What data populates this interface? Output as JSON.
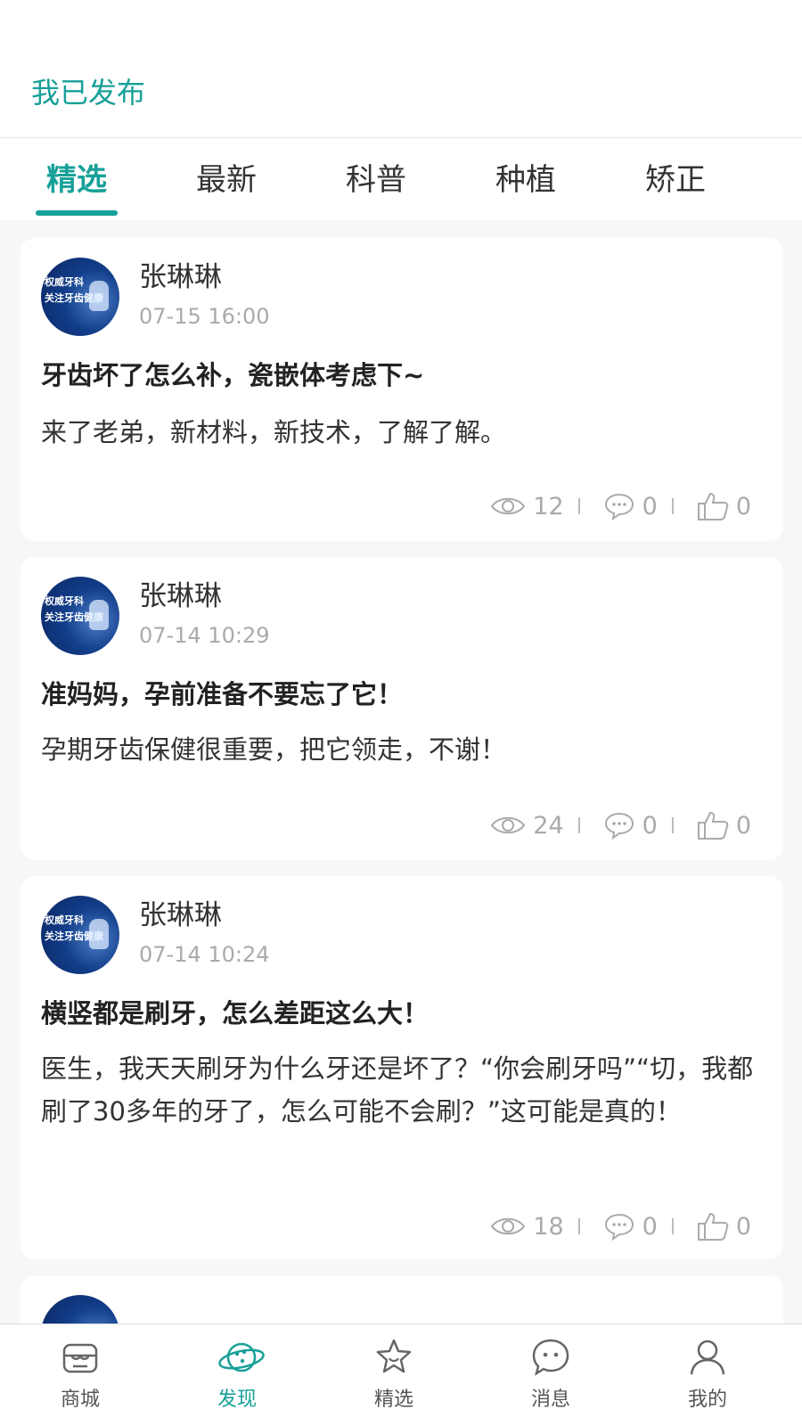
{
  "header": {
    "published_label": "我已发布"
  },
  "tabs": [
    {
      "label": "精选",
      "active": true
    },
    {
      "label": "最新",
      "active": false
    },
    {
      "label": "科普",
      "active": false
    },
    {
      "label": "种植",
      "active": false
    },
    {
      "label": "矫正",
      "active": false
    }
  ],
  "avatar": {
    "line1": "权威牙科",
    "line2": "关注牙齿健康"
  },
  "posts": [
    {
      "author": "张琳琳",
      "time": "07-15 16:00",
      "title": "牙齿坏了怎么补，瓷嵌体考虑下~",
      "body": "来了老弟，新材料，新技术，了解了解。",
      "views": "12",
      "comments": "0",
      "likes": "0"
    },
    {
      "author": "张琳琳",
      "time": "07-14 10:29",
      "title": "准妈妈，孕前准备不要忘了它！",
      "body": "孕期牙齿保健很重要，把它领走，不谢！",
      "views": "24",
      "comments": "0",
      "likes": "0"
    },
    {
      "author": "张琳琳",
      "time": "07-14 10:24",
      "title": "横竖都是刷牙，怎么差距这么大！",
      "body": "医生，我天天刷牙为什么牙还是坏了？“你会刷牙吗”“切，我都刷了30多年的牙了，怎么可能不会刷？”这可能是真的！",
      "views": "18",
      "comments": "0",
      "likes": "0"
    }
  ],
  "nav": [
    {
      "label": "商城",
      "icon": "store-icon",
      "active": false
    },
    {
      "label": "发现",
      "icon": "planet-icon",
      "active": true
    },
    {
      "label": "精选",
      "icon": "star-icon",
      "active": false
    },
    {
      "label": "消息",
      "icon": "message-icon",
      "active": false
    },
    {
      "label": "我的",
      "icon": "user-icon",
      "active": false
    }
  ],
  "colors": {
    "accent": "#17a098",
    "muted": "#aaaaaa",
    "background": "#f7f7f7"
  }
}
